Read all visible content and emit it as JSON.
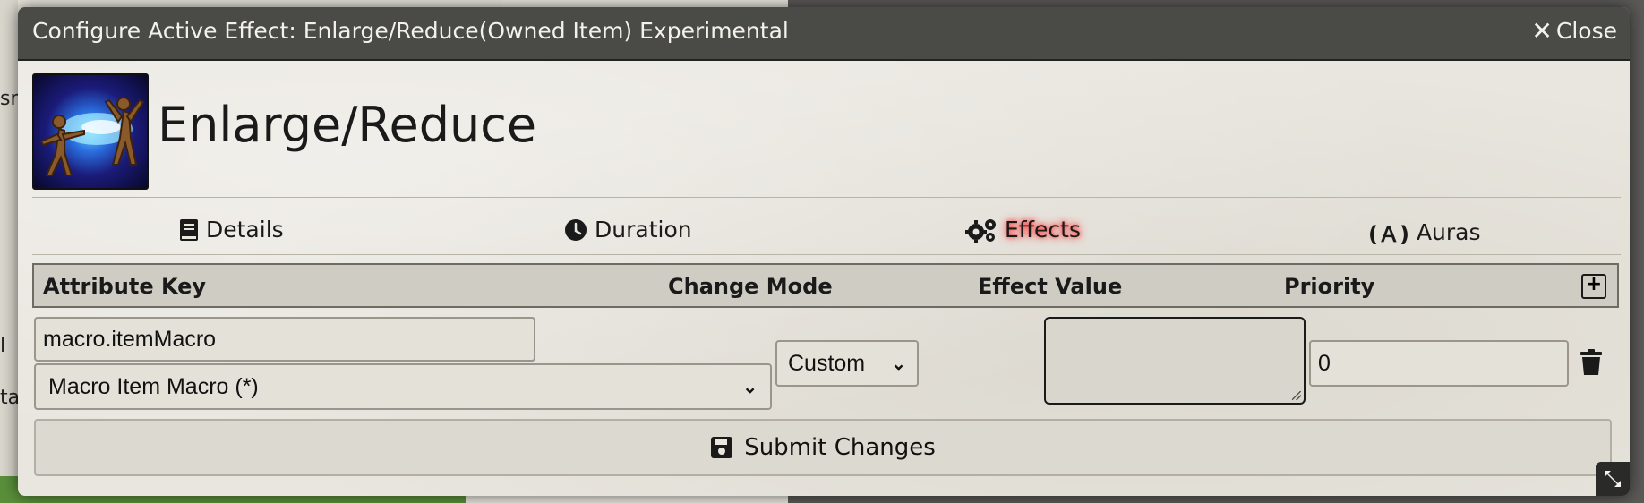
{
  "window": {
    "title": "Configure Active Effect: Enlarge/Reduce(Owned Item) Experimental",
    "close_label": "Close"
  },
  "effect": {
    "name": "Enlarge/Reduce",
    "image_icon": "spell-enlarge-reduce-image"
  },
  "tabs": [
    {
      "label": "Details",
      "icon": "book-icon"
    },
    {
      "label": "Duration",
      "icon": "clock-icon"
    },
    {
      "label": "Effects",
      "icon": "gears-icon",
      "active": true
    },
    {
      "label": "Auras",
      "icon": "aura-icon"
    }
  ],
  "table": {
    "headers": [
      "Attribute Key",
      "Change Mode",
      "Effect Value",
      "Priority"
    ],
    "rows": [
      {
        "attribute_key": "macro.itemMacro",
        "attribute_select": "Macro Item Macro (*)",
        "change_mode": "Custom",
        "effect_value": "",
        "priority": "0"
      }
    ]
  },
  "submit_label": "Submit Changes",
  "background": {
    "left_fragments": [
      "sm",
      "l",
      "tat"
    ]
  },
  "colors": {
    "titlebar": "#4a4a46",
    "active_tab_glow": "#ff2222",
    "sheet": "#e9e6df"
  }
}
